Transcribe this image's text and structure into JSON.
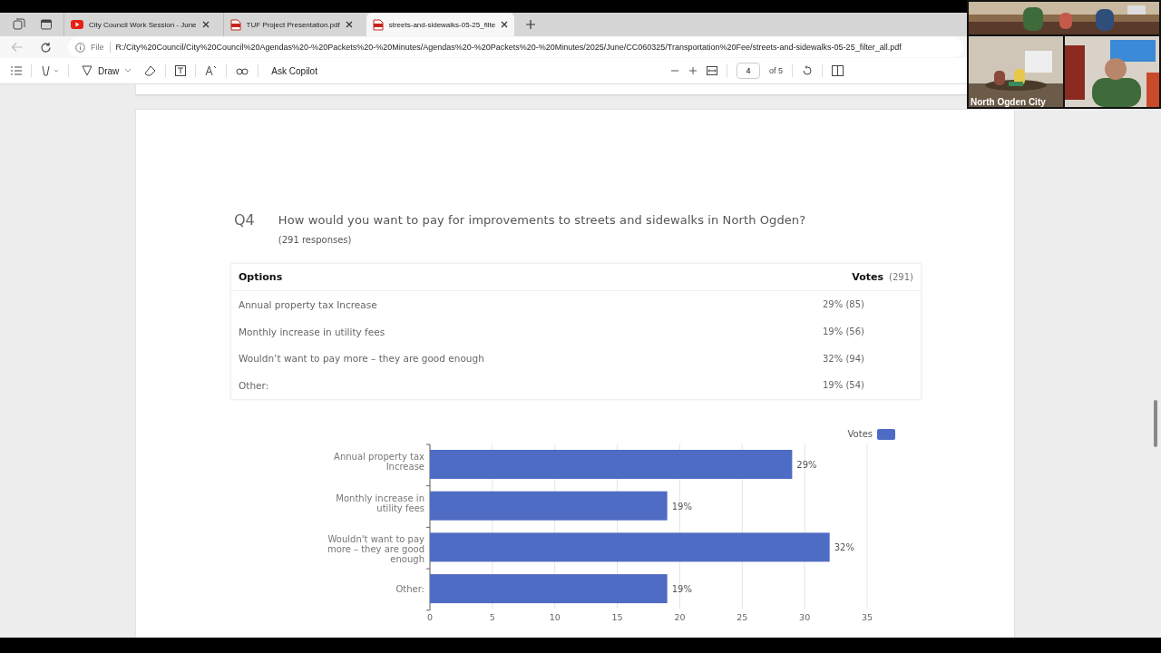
{
  "browser": {
    "tabs": [
      {
        "title": "City Council Work Session - June",
        "kind": "video",
        "selected": false
      },
      {
        "title": "TUF Project Presentation.pdf",
        "kind": "pdf",
        "selected": false
      },
      {
        "title": "streets-and-sidewalks-05-25_filte",
        "kind": "pdf",
        "selected": true
      }
    ],
    "address": {
      "scheme": "File",
      "url": "R:/City%20Council/City%20Council%20Agendas%20-%20Packets%20-%20Minutes/Agendas%20-%20Packets%20-%20Minutes/2025/June/CC060325/Transportation%20Fee/streets-and-sidewalks-05-25_filter_all.pdf"
    }
  },
  "pdf_toolbar": {
    "draw": "Draw",
    "copilot": "Ask Copilot",
    "page": "4",
    "page_count": "of 5"
  },
  "question": {
    "number": "Q4",
    "text": "How would you want to pay for improvements to streets and sidewalks in North Ogden?",
    "responses": "(291 responses)"
  },
  "table": {
    "columns": [
      "Options",
      "Votes"
    ],
    "total": "(291)",
    "rows": [
      {
        "option": "Annual property tax Increase",
        "votes": "29% (85)"
      },
      {
        "option": "Monthly increase in utility fees",
        "votes": "19% (56)"
      },
      {
        "option": "Wouldn’t want to pay more – they are good enough",
        "votes": "32% (94)"
      },
      {
        "option": "Other:",
        "votes": "19% (54)"
      }
    ]
  },
  "chart_data": {
    "type": "bar",
    "orientation": "horizontal",
    "categories": [
      "Annual property tax Increase",
      "Monthly increase in utility fees",
      "Wouldn't want to pay more – they are good enough",
      "Other"
    ],
    "grid": true,
    "series": [
      {
        "name": "Votes",
        "color": "#4f6cc4",
        "values": [
          29,
          19,
          32,
          19
        ]
      }
    ],
    "xlim": [
      0,
      35
    ],
    "xticks": [
      0,
      5,
      10,
      15,
      20,
      25,
      30,
      35
    ],
    "value_labels": [
      "29%",
      "19%",
      "32%",
      "19%"
    ]
  },
  "chart_labels": {
    "separator": ":",
    "with_separator": [
      false,
      false,
      false,
      true
    ]
  },
  "video_call": {
    "label": "North Ogden City"
  }
}
